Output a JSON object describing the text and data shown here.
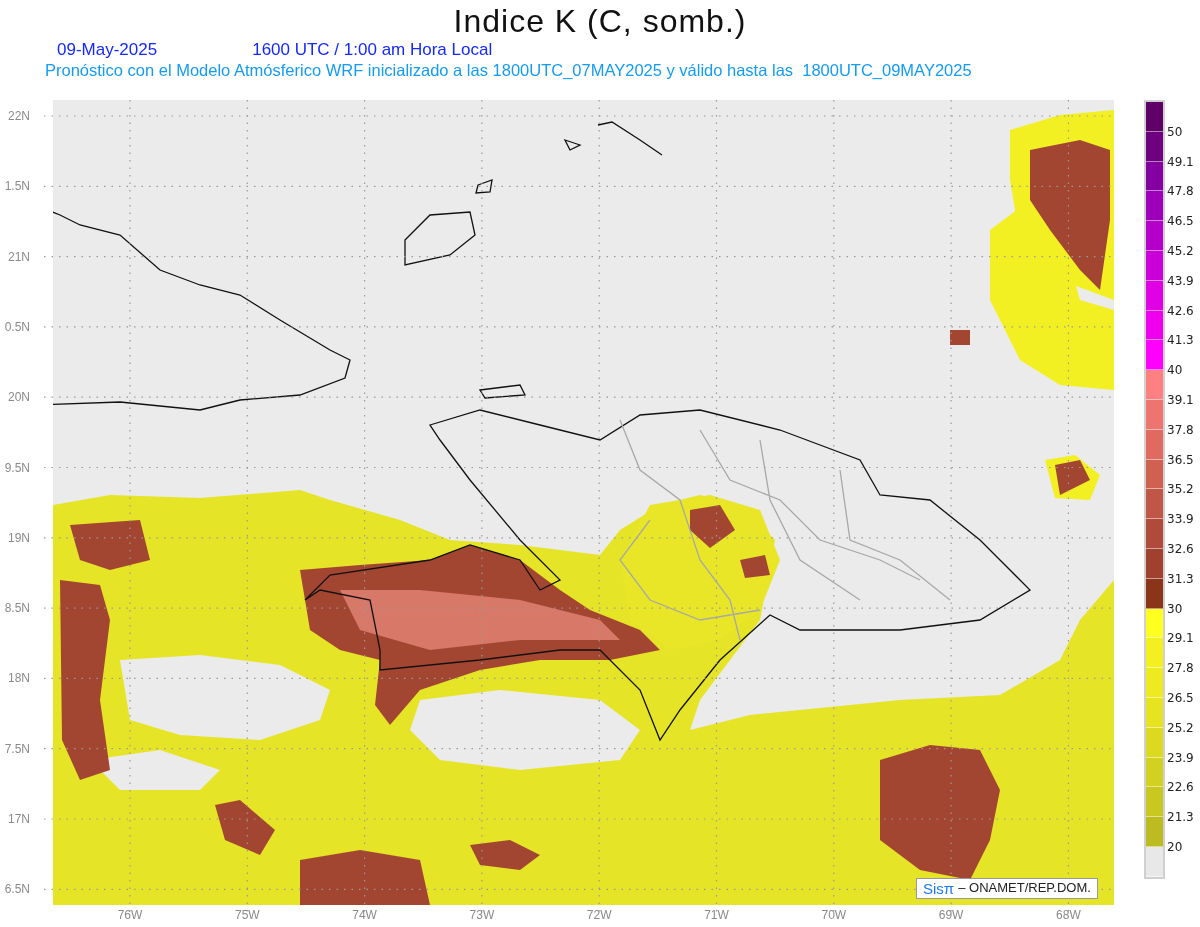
{
  "title": "Indice K (C, somb.)",
  "date": "09-May-2025",
  "time": "1600 UTC / 1:00 am Hora Local",
  "subtitle": "Pronóstico con el Modelo Atmósferico WRF inicializado a las 1800UTC_07MAY2025 y válido hasta las  1800UTC_09MAY2025",
  "map": {
    "y_axis_labels": [
      "22N",
      "1.5N",
      "21N",
      "0.5N",
      "20N",
      "9.5N",
      "19N",
      "8.5N",
      "18N",
      "7.5N",
      "17N",
      "6.5N"
    ],
    "x_axis_labels": [
      "76W",
      "75W",
      "74W",
      "73W",
      "72W",
      "71W",
      "70W",
      "69W",
      "68W"
    ],
    "credit": {
      "logo": "Sisπ",
      "text": "– ONAMET/REP.DOM."
    }
  },
  "colorbar": {
    "cells": [
      {
        "label": "50",
        "color": "#5e0068"
      },
      {
        "label": "49.1",
        "color": "#6e0080"
      },
      {
        "label": "47.8",
        "color": "#8400a0"
      },
      {
        "label": "46.5",
        "color": "#9c00b8"
      },
      {
        "label": "45.2",
        "color": "#b400c8"
      },
      {
        "label": "43.9",
        "color": "#ca00d8"
      },
      {
        "label": "42.6",
        "color": "#e000e4"
      },
      {
        "label": "41.3",
        "color": "#ee00ee"
      },
      {
        "label": "40",
        "color": "#ff00ff"
      },
      {
        "label": "39.1",
        "color": "#ff8080"
      },
      {
        "label": "37.8",
        "color": "#ee7470"
      },
      {
        "label": "36.5",
        "color": "#e06a60"
      },
      {
        "label": "35.2",
        "color": "#d06050"
      },
      {
        "label": "33.9",
        "color": "#c05646"
      },
      {
        "label": "32.6",
        "color": "#b04a3a"
      },
      {
        "label": "31.3",
        "color": "#a0402e"
      },
      {
        "label": "30",
        "color": "#8a3418"
      },
      {
        "label": "29.1",
        "color": "#ffff20"
      },
      {
        "label": "27.8",
        "color": "#f4f020"
      },
      {
        "label": "26.5",
        "color": "#eeea20"
      },
      {
        "label": "25.2",
        "color": "#e6e420"
      },
      {
        "label": "23.9",
        "color": "#dcda20"
      },
      {
        "label": "22.6",
        "color": "#d2d020"
      },
      {
        "label": "21.3",
        "color": "#c8c820"
      },
      {
        "label": "20",
        "color": "#bcbc20"
      }
    ],
    "below_range": {
      "color": "#e8e8e8"
    }
  }
}
